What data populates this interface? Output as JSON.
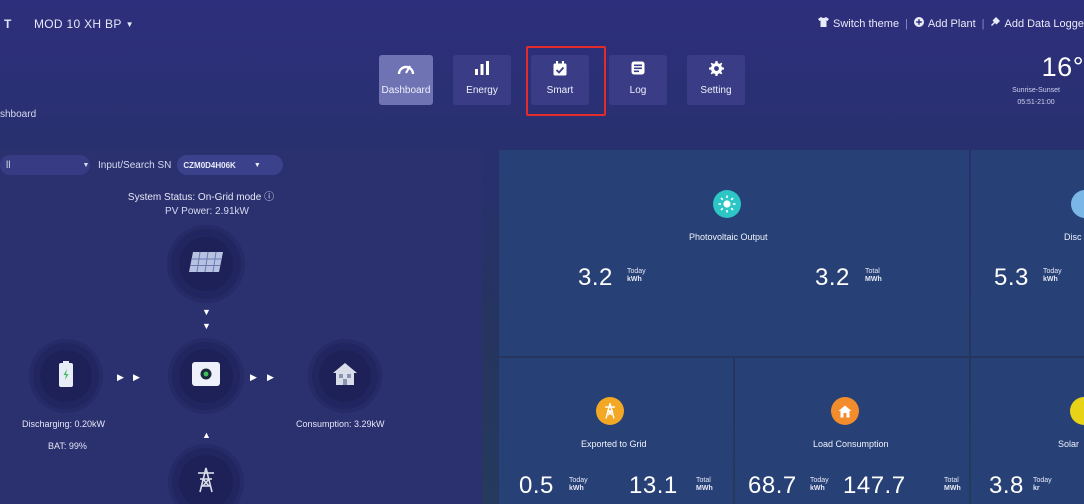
{
  "topbar": {
    "brand_tail": "T",
    "plant_name": "MOD 10 XH BP",
    "actions": [
      {
        "label": "Switch theme",
        "icon": "shirt-icon"
      },
      {
        "label": "Add Plant",
        "icon": "plus-circle-icon"
      },
      {
        "label": "Add Data Logge",
        "icon": "plug-icon"
      }
    ]
  },
  "tabs": [
    {
      "label": "Dashboard",
      "icon": "gauge-icon",
      "active": true
    },
    {
      "label": "Energy",
      "icon": "bar-chart-icon",
      "active": false
    },
    {
      "label": "Smart",
      "icon": "calendar-check-icon",
      "active": false
    },
    {
      "label": "Log",
      "icon": "log-icon",
      "active": false
    },
    {
      "label": "Setting",
      "icon": "gear-icon",
      "active": false
    }
  ],
  "breadcrumb": "shboard",
  "weather": {
    "temperature": "16°",
    "sunrise_label": "Sunrise-Sunset",
    "sunrise_time": "05:51-21:00"
  },
  "left": {
    "device_select": "ll",
    "sn_label": "Input/Search SN",
    "sn_value": "CZM0D4H06K",
    "system_status": "System Status:  On-Grid mode ⓘ",
    "pv_power": "PV Power:  2.91kW",
    "discharging": "Discharging:  0.20kW",
    "bat": "BAT:  99%",
    "consumption": "Consumption:  3.29kW"
  },
  "cards": {
    "pv": {
      "title": "Photovoltaic Output",
      "today_value": "3.2",
      "today_label": "Today",
      "today_unit": "kWh",
      "total_value": "3.2",
      "total_label": "Total",
      "total_unit": "MWh"
    },
    "disc": {
      "title": "Disc",
      "today_value": "5.3",
      "today_label": "Today",
      "today_unit": "kWh"
    },
    "grid": {
      "title": "Exported to Grid",
      "today_value": "0.5",
      "today_label": "Today",
      "today_unit": "kWh",
      "total_value": "13.1",
      "total_label": "Total",
      "total_unit": "MWh"
    },
    "load": {
      "title": "Load Consumption",
      "today_value": "68.7",
      "today_label": "Today",
      "today_unit": "kWh",
      "total_value": "147.7",
      "total_label": "Total",
      "total_unit": "MWh"
    },
    "solar": {
      "title": "Solar",
      "today_value": "3.8",
      "today_label": "Today",
      "today_unit": "kr"
    }
  },
  "colors": {
    "background": "#2b2f78",
    "card": "#274076",
    "highlight": "#e32b2b",
    "pv_icon": "#2cc6c6",
    "grid_icon": "#f2a825",
    "load_icon": "#f28c2c",
    "solar_icon": "#e8d317",
    "disc_icon": "#7ab7e8"
  }
}
